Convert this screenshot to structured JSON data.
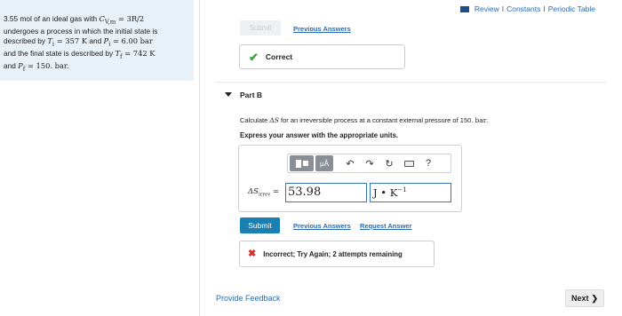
{
  "problem": {
    "line1_a": "3.55 mol of an ideal gas with ",
    "line1_math": "C",
    "line1_sub": "V,m",
    "line1_b": " = 3R/2",
    "line2": "undergoes a process in which the initial state is",
    "line3_a": "described by ",
    "line3_T": "T",
    "line3_sub": "i",
    "line3_b": " = 357 K",
    "line3_c": " and ",
    "line3_P": "P",
    "line3_sub2": "i",
    "line3_d": " = 6.00 bar",
    "line4_a": "and the final state is described by ",
    "line4_T": "T",
    "line4_sub": "f",
    "line4_b": " = 742 K",
    "line5_a": "and ",
    "line5_P": "P",
    "line5_sub": "f",
    "line5_b": " = 150. bar."
  },
  "top_links": {
    "review": "Review",
    "sep1": "I",
    "constants": "Constants",
    "sep2": "I",
    "periodic": "Periodic Table"
  },
  "part_a": {
    "submit_label": "Submit",
    "previous_answers": "Previous Answers",
    "correct_label": "Correct"
  },
  "part_b": {
    "label": "Part B",
    "calc_text_a": "Calculate ",
    "calc_math": "ΔS",
    "calc_text_b": " for an irreversible process at a constant external pressure of 150. ",
    "calc_unit": "bar",
    "calc_end": ".",
    "express_text": "Express your answer with the appropriate units.",
    "toolbar": {
      "mu_label": "μÅ",
      "help": "?"
    },
    "answer_label_a": "ΔS",
    "answer_label_sub": "irrev",
    "answer_label_eq": " =",
    "answer_value": "53.98",
    "unit_value": "J • K",
    "unit_sup": "−1",
    "submit_label": "Submit",
    "previous_answers": "Previous Answers",
    "request_answer": "Request Answer",
    "incorrect_label": "Incorrect; Try Again; 2 attempts remaining"
  },
  "footer": {
    "provide_feedback": "Provide Feedback",
    "next_label": "Next"
  },
  "colors": {
    "link": "#2a6bb0",
    "submit_bg": "#1a7fb1",
    "correct": "#3e9f3e",
    "incorrect": "#d32f2f",
    "problem_bg": "#e8f1f8"
  }
}
